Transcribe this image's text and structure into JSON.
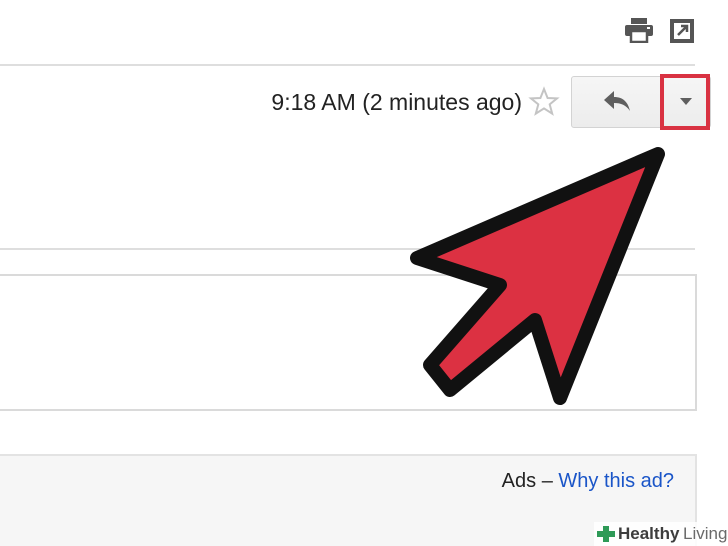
{
  "toolbar": {
    "print_icon": "print-icon",
    "open_new_window_icon": "open-in-new-window-icon"
  },
  "header": {
    "timestamp": "9:18 AM (2 minutes ago)",
    "star_icon": "star-icon",
    "reply_icon": "reply-icon",
    "more_icon": "chevron-down-icon"
  },
  "ads": {
    "label": "Ads –",
    "link": "Why this ad?"
  },
  "watermark": {
    "part1": "Healthy",
    "part2": "Living"
  },
  "colors": {
    "highlight": "#d93242",
    "arrow_fill": "#dc3142",
    "link": "#1a55c8"
  }
}
